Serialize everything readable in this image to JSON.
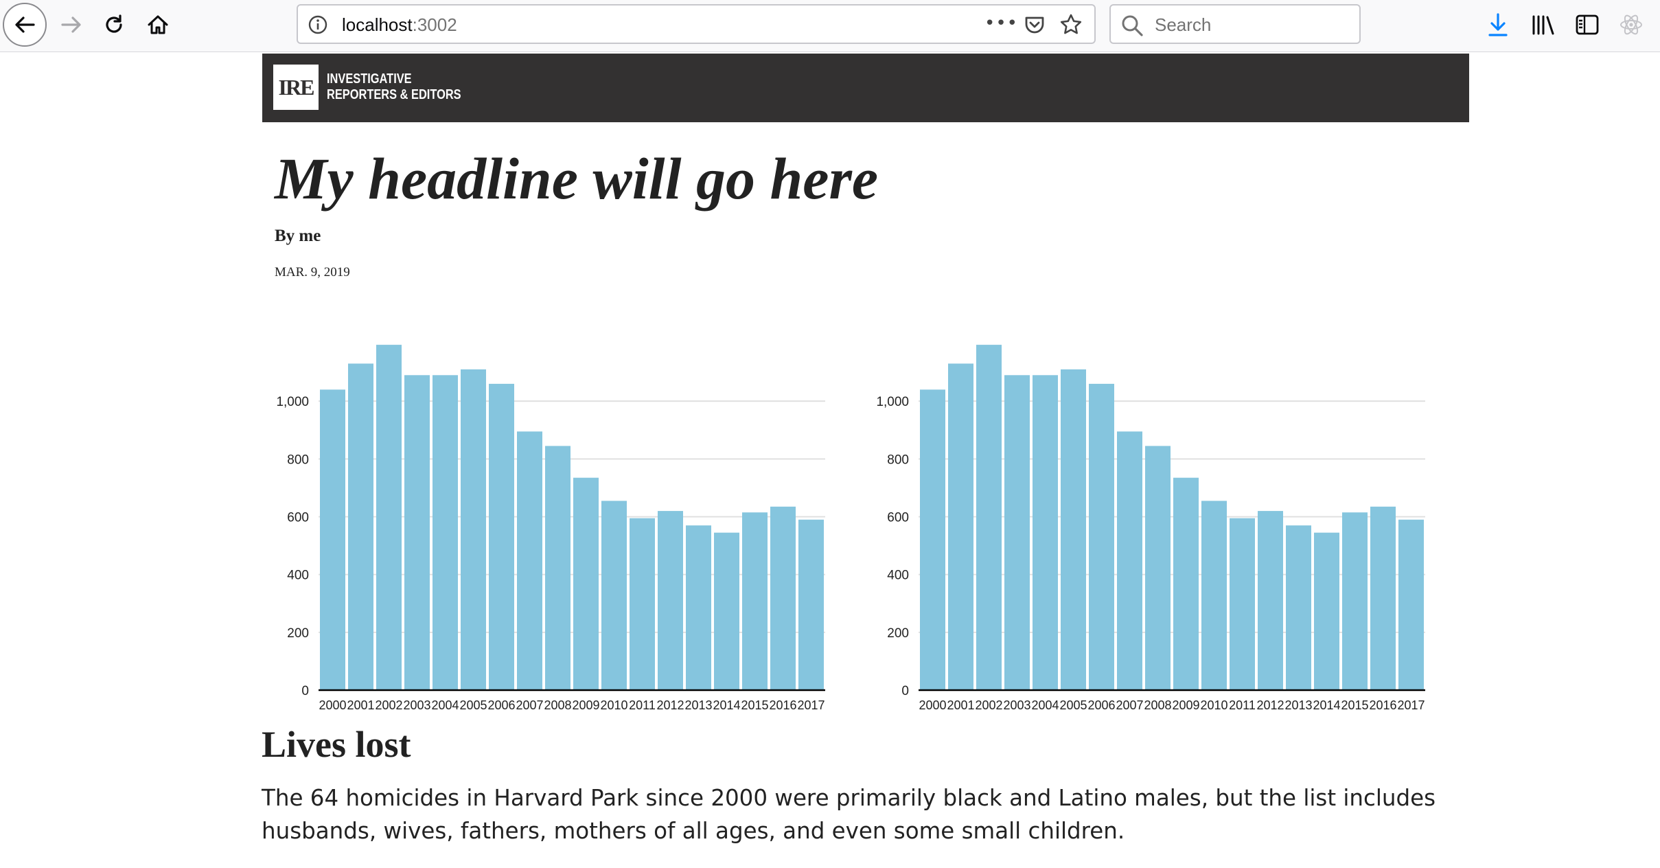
{
  "browser": {
    "url_host": "localhost",
    "url_port": ":3002",
    "search_placeholder": "Search",
    "more_label": "•••"
  },
  "site": {
    "logo_mark": "IRE",
    "logo_line1": "INVESTIGATIVE",
    "logo_line2": "REPORTERS & EDITORS"
  },
  "article": {
    "headline": "My headline will go here",
    "byline": "By me",
    "date": "MAR. 9, 2019",
    "section_title": "Lives lost",
    "paragraph": "The 64 homicides in Harvard Park since 2000 were primarily black and Latino males, but the list includes husbands, wives, fathers, mothers of all ages, and even some small children."
  },
  "colors": {
    "bar": "#85c5de",
    "header_bg": "#333131",
    "gridline": "#e0e0e0"
  },
  "chart_data": [
    {
      "type": "bar",
      "categories": [
        "2000",
        "2001",
        "2002",
        "2003",
        "2004",
        "2005",
        "2006",
        "2007",
        "2008",
        "2009",
        "2010",
        "2011",
        "2012",
        "2013",
        "2014",
        "2015",
        "2016",
        "2017"
      ],
      "values": [
        1040,
        1130,
        1195,
        1090,
        1090,
        1110,
        1060,
        895,
        845,
        735,
        655,
        595,
        620,
        570,
        545,
        615,
        635,
        590
      ],
      "yticks": [
        0,
        200,
        400,
        600,
        800,
        1000
      ],
      "ytick_labels": [
        "0",
        "200",
        "400",
        "600",
        "800",
        "1,000"
      ],
      "ylim": [
        0,
        1200
      ],
      "grid": true
    },
    {
      "type": "bar",
      "categories": [
        "2000",
        "2001",
        "2002",
        "2003",
        "2004",
        "2005",
        "2006",
        "2007",
        "2008",
        "2009",
        "2010",
        "2011",
        "2012",
        "2013",
        "2014",
        "2015",
        "2016",
        "2017"
      ],
      "values": [
        1040,
        1130,
        1195,
        1090,
        1090,
        1110,
        1060,
        895,
        845,
        735,
        655,
        595,
        620,
        570,
        545,
        615,
        635,
        590
      ],
      "yticks": [
        0,
        200,
        400,
        600,
        800,
        1000
      ],
      "ytick_labels": [
        "0",
        "200",
        "400",
        "600",
        "800",
        "1,000"
      ],
      "ylim": [
        0,
        1200
      ],
      "grid": true
    }
  ]
}
